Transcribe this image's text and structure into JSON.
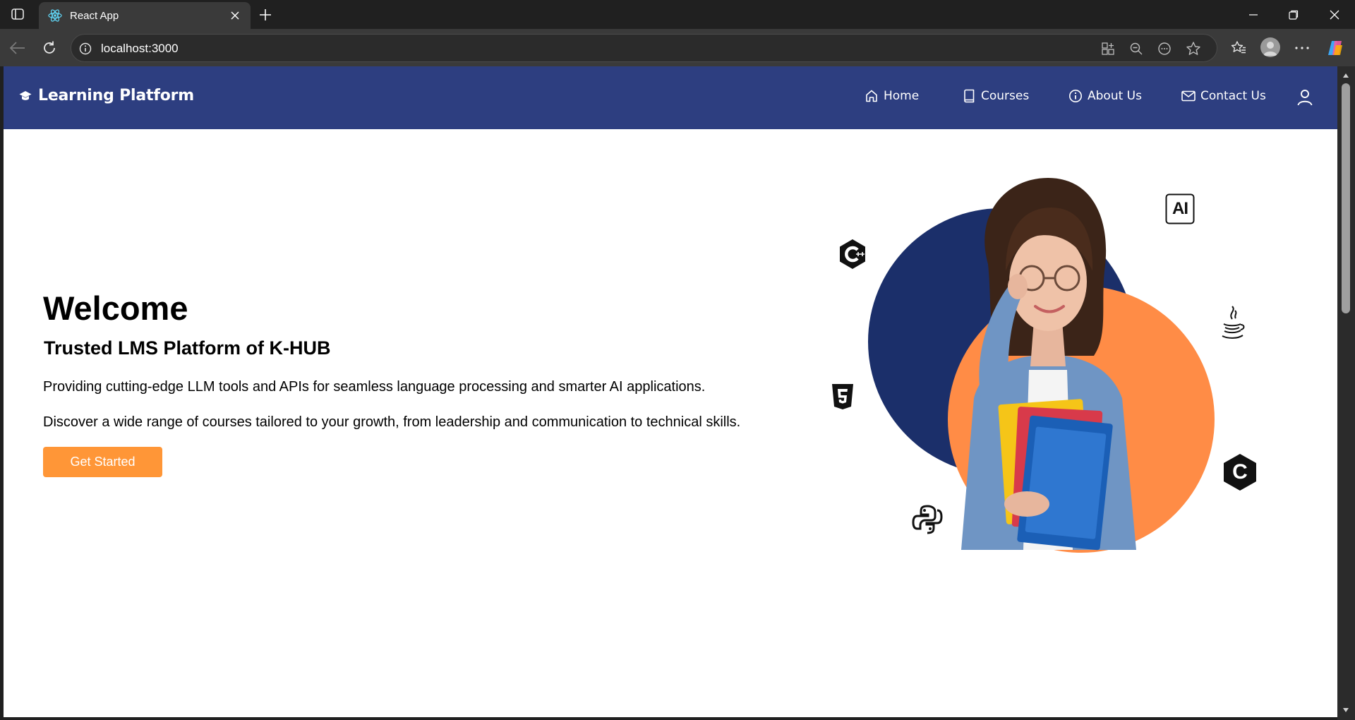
{
  "browser": {
    "tab": {
      "title": "React App"
    },
    "address": {
      "url": "localhost:3000"
    }
  },
  "site": {
    "brand": "Learning Platform",
    "nav": {
      "home": "Home",
      "courses": "Courses",
      "about": "About Us",
      "contact": "Contact Us"
    }
  },
  "hero": {
    "title": "Welcome",
    "subtitle": "Trusted LMS Platform of K-HUB",
    "paragraph1": "Providing cutting-edge LLM tools and APIs for seamless language processing and smarter AI applications.",
    "paragraph2": "Discover a wide range of courses tailored to your growth, from leadership and communication to technical skills.",
    "cta": "Get Started",
    "ai_badge": "AI",
    "c_badge": "C"
  },
  "colors": {
    "nav_bg": "#2d3e80",
    "cta_bg": "#ff9637",
    "circle_navy": "#1b2f6a",
    "circle_orange": "#ff8c46"
  },
  "icons": [
    "sidebar-toggle-icon",
    "react-favicon-icon",
    "close-icon",
    "plus-icon",
    "back-arrow-icon",
    "refresh-icon",
    "info-icon",
    "app-available-icon",
    "zoom-out-icon",
    "read-aloud-icon",
    "star-icon",
    "favorites-icon",
    "more-icon",
    "copilot-icon",
    "graduation-cap-icon",
    "home-icon",
    "book-icon",
    "info-circle-icon",
    "mail-icon",
    "user-icon",
    "cpp-logo-icon",
    "html5-logo-icon",
    "python-logo-icon",
    "java-logo-icon",
    "ai-badge-icon",
    "c-logo-icon"
  ]
}
